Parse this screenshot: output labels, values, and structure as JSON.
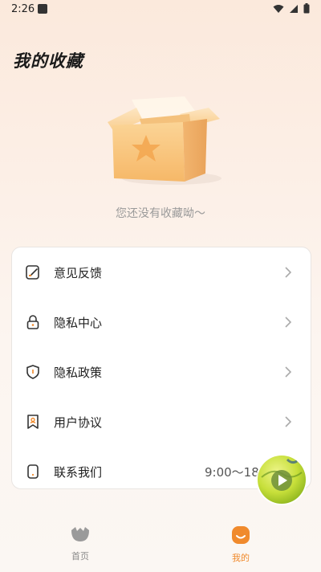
{
  "status": {
    "time": "2:26"
  },
  "page": {
    "title": "我的收藏",
    "empty_text": "您还没有收藏呦～"
  },
  "menu": [
    {
      "label": "意见反馈",
      "icon": "feedback-edit-icon"
    },
    {
      "label": "隐私中心",
      "icon": "lock-icon"
    },
    {
      "label": "隐私政策",
      "icon": "shield-icon"
    },
    {
      "label": "用户协议",
      "icon": "bookmark-user-icon"
    },
    {
      "label": "联系我们",
      "icon": "phone-icon",
      "extra": "9:00～18"
    }
  ],
  "tabs": [
    {
      "label": "首页",
      "icon": "home-icon"
    },
    {
      "label": "我的",
      "icon": "profile-icon",
      "active": true
    }
  ],
  "colors": {
    "accent": "#f08a2c",
    "tab_inactive": "#8a8a8a",
    "icon_dark": "#333333"
  }
}
